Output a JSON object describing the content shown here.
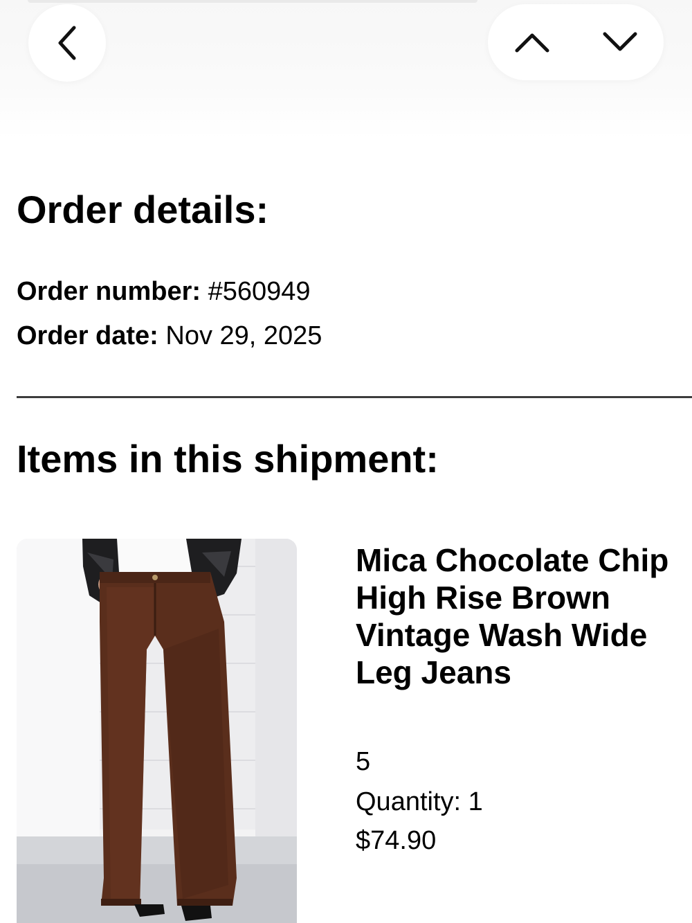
{
  "nav": {
    "back_icon": "chevron-left-icon",
    "prev_icon": "chevron-up-icon",
    "next_icon": "chevron-down-icon"
  },
  "order": {
    "heading": "Order details:",
    "number_label": "Order number:",
    "number_value": "#560949",
    "date_label": "Order date:",
    "date_value": "Nov 29, 2025"
  },
  "shipment": {
    "heading": "Items in this shipment:",
    "items": [
      {
        "title": "Mica Chocolate Chip High Rise Brown Vintage Wash Wide Leg Jeans",
        "size": "5",
        "quantity": "Quantity: 1",
        "price": "$74.90",
        "image": "brown-wide-leg-jeans-photo"
      }
    ]
  },
  "colors": {
    "divider": "#3c3c3c",
    "jeans": "#5a2e1c"
  }
}
